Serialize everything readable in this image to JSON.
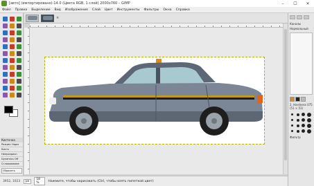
{
  "window": {
    "title": "[авто] (импортировано)-14.0 (Цвета RGB, 1 слой) 2000x760 – GIMP",
    "minimize": "–",
    "maximize": "☐",
    "close": "✕"
  },
  "menubar": [
    "Файл",
    "Правка",
    "Выделение",
    "Вид",
    "Изображение",
    "Слой",
    "Цвет",
    "Инструменты",
    "Фильтры",
    "Окна",
    "Справка"
  ],
  "image_tabs": {
    "close_glyph": "×"
  },
  "toolbox": {
    "tools": [
      "move",
      "align",
      "crop",
      "rotate",
      "scale",
      "shear",
      "perspective",
      "flip",
      "cage",
      "rect-select",
      "ellipse-select",
      "free-select",
      "fuzzy-select",
      "color-select",
      "scissors",
      "foreground-select",
      "paths",
      "color-picker",
      "zoom",
      "measure",
      "text",
      "bucket-fill",
      "gradient",
      "pencil",
      "paintbrush",
      "eraser",
      "airbrush",
      "ink",
      "mypaint",
      "clone",
      "heal",
      "perspective-clone",
      "blur",
      "smudge",
      "dodge-burn",
      "warp"
    ],
    "tool_options": {
      "title": "Кисточка",
      "mode": "Режим: Норм",
      "brush": "Кисть",
      "preset": "Непрозрачн",
      "dynamics": "Dynamics Off",
      "smoothing": "Сглаживание",
      "reset_button": "Сбросить"
    }
  },
  "colors": {
    "foreground": "#000000",
    "background": "#ffffff"
  },
  "statusbar": {
    "coord": "3952, 1023",
    "units": "px",
    "zoom": "18 %",
    "message": "Нажмите, чтобы нарисовать (Ctrl, чтобы взять пипеткой цвет)"
  },
  "right_dock": {
    "layers_label": "Каналы",
    "layer_mode": "Нормальный",
    "brushes_label": "2. Hardness 075 (51 × 51)",
    "brush_filter": "Фильтр"
  },
  "canvas": {
    "background": "#ffffff",
    "subject": "taxi-car"
  }
}
